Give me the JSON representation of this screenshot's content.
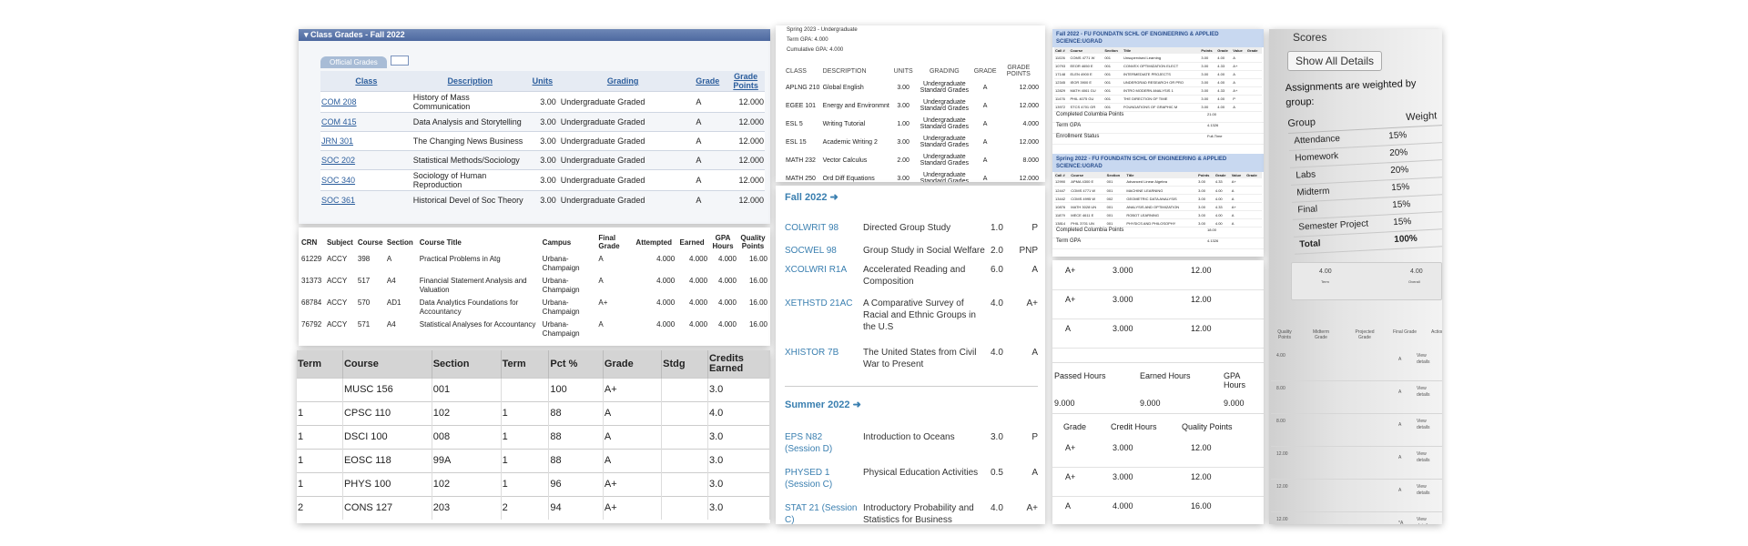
{
  "p1": {
    "header": "Class Grades - Fall 2022",
    "tab_official": "Official Grades",
    "tab_other": "",
    "columns": [
      "Class",
      "Description",
      "Units",
      "Grading",
      "Grade",
      "Grade Points"
    ],
    "rows": [
      {
        "class": "COM 208",
        "desc": "History of Mass Communication",
        "units": "3.00",
        "grading": "Undergraduate Graded",
        "grade": "A",
        "points": "12.000"
      },
      {
        "class": "COM 415",
        "desc": "Data Analysis and Storytelling",
        "units": "3.00",
        "grading": "Undergraduate Graded",
        "grade": "A",
        "points": "12.000"
      },
      {
        "class": "JRN 301",
        "desc": "The Changing News Business",
        "units": "3.00",
        "grading": "Undergraduate Graded",
        "grade": "A",
        "points": "12.000"
      },
      {
        "class": "SOC 202",
        "desc": "Statistical Methods/Sociology",
        "units": "3.00",
        "grading": "Undergraduate Graded",
        "grade": "A",
        "points": "12.000"
      },
      {
        "class": "SOC 340",
        "desc": "Sociology of Human Reproduction",
        "units": "3.00",
        "grading": "Undergraduate Graded",
        "grade": "A",
        "points": "12.000"
      },
      {
        "class": "SOC 361",
        "desc": "Historical Devel of Soc Theory",
        "units": "3.00",
        "grading": "Undergraduate Graded",
        "grade": "A",
        "points": "12.000"
      }
    ]
  },
  "p2": {
    "columns": [
      "CRN",
      "Subject",
      "Course",
      "Section",
      "Course Title",
      "Campus",
      "Final Grade",
      "Attempted",
      "Earned",
      "GPA Hours",
      "Quality Points"
    ],
    "rows": [
      {
        "crn": "61229",
        "subj": "ACCY",
        "course": "398",
        "sec": "A",
        "title": "Practical Problems in Atg",
        "campus": "Urbana-Champaign",
        "grade": "A",
        "att": "4.000",
        "earn": "4.000",
        "gpa": "4.000",
        "qp": "16.00"
      },
      {
        "crn": "31373",
        "subj": "ACCY",
        "course": "517",
        "sec": "A4",
        "title": "Financial Statement Analysis and Valuation",
        "campus": "Urbana-Champaign",
        "grade": "A",
        "att": "4.000",
        "earn": "4.000",
        "gpa": "4.000",
        "qp": "16.00"
      },
      {
        "crn": "68784",
        "subj": "ACCY",
        "course": "570",
        "sec": "AD1",
        "title": "Data Analytics Foundations for Accountancy",
        "campus": "Urbana-Champaign",
        "grade": "A+",
        "att": "4.000",
        "earn": "4.000",
        "gpa": "4.000",
        "qp": "16.00"
      },
      {
        "crn": "76792",
        "subj": "ACCY",
        "course": "571",
        "sec": "A4",
        "title": "Statistical Analyses for Accountancy",
        "campus": "Urbana-Champaign",
        "grade": "A",
        "att": "4.000",
        "earn": "4.000",
        "gpa": "4.000",
        "qp": "16.00"
      }
    ]
  },
  "p3": {
    "columns": [
      "Term",
      "Course",
      "Section",
      "Term",
      "Pct %",
      "Grade",
      "Stdg",
      "Credits Earned"
    ],
    "rows": [
      {
        "term": "",
        "course": "MUSC 156",
        "section": "001",
        "term2": "",
        "pct": "100",
        "grade": "A+",
        "stdg": "",
        "credits": "3.0"
      },
      {
        "term": "1",
        "course": "CPSC 110",
        "section": "102",
        "term2": "1",
        "pct": "88",
        "grade": "A",
        "stdg": "",
        "credits": "4.0"
      },
      {
        "term": "1",
        "course": "DSCI 100",
        "section": "008",
        "term2": "1",
        "pct": "88",
        "grade": "A",
        "stdg": "",
        "credits": "3.0"
      },
      {
        "term": "1",
        "course": "EOSC 118",
        "section": "99A",
        "term2": "1",
        "pct": "88",
        "grade": "A",
        "stdg": "",
        "credits": "3.0"
      },
      {
        "term": "1",
        "course": "PHYS 100",
        "section": "102",
        "term2": "1",
        "pct": "96",
        "grade": "A+",
        "stdg": "",
        "credits": "3.0"
      },
      {
        "term": "2",
        "course": "CONS 127",
        "section": "203",
        "term2": "2",
        "pct": "94",
        "grade": "A+",
        "stdg": "",
        "credits": "3.0"
      }
    ]
  },
  "p4": {
    "term": "Spring 2023 - Undergraduate",
    "term_gpa": "Term GPA: 4.000",
    "cum_gpa": "Cumulative GPA: 4.000",
    "columns": [
      "CLASS",
      "DESCRIPTION",
      "UNITS",
      "GRADING",
      "GRADE",
      "GRADE POINTS"
    ],
    "rows": [
      {
        "cls": "APLNG 210",
        "desc": "Global English",
        "units": "3.00",
        "grading": "Undergraduate Standard Grades",
        "grade": "A",
        "points": "12.000"
      },
      {
        "cls": "EGEE 101",
        "desc": "Energy and Environmnt",
        "units": "3.00",
        "grading": "Undergraduate Standard Grades",
        "grade": "A",
        "points": "12.000"
      },
      {
        "cls": "ESL 5",
        "desc": "Writing Tutorial",
        "units": "1.00",
        "grading": "Undergraduate Standard Grades",
        "grade": "A",
        "points": "4.000"
      },
      {
        "cls": "ESL 15",
        "desc": "Academic Writing 2",
        "units": "3.00",
        "grading": "Undergraduate Standard Grades",
        "grade": "A",
        "points": "12.000"
      },
      {
        "cls": "MATH 232",
        "desc": "Vector Calculus",
        "units": "2.00",
        "grading": "Undergraduate Standard Grades",
        "grade": "A",
        "points": "8.000"
      },
      {
        "cls": "MATH 250",
        "desc": "Ord Diff Equations",
        "units": "3.00",
        "grading": "Undergraduate Standard Grades",
        "grade": "A",
        "points": "12.000"
      }
    ]
  },
  "p5": {
    "fall_title": "Fall 2022",
    "fall_rows": [
      {
        "code": "COLWRIT 98",
        "title": "Directed Group Study",
        "units": "1.0",
        "grade": "P"
      },
      {
        "code": "SOCWEL 98",
        "title": "Group Study in Social Welfare",
        "units": "2.0",
        "grade": "PNP"
      },
      {
        "code": "XCOLWRI R1A",
        "title": "Accelerated Reading and Composition",
        "units": "6.0",
        "grade": "A"
      },
      {
        "code": "XETHSTD 21AC",
        "title": "A Comparative Survey of Racial and Ethnic Groups in the U.S",
        "units": "4.0",
        "grade": "A+"
      },
      {
        "code": "XHISTOR 7B",
        "title": "The United States from Civil War to Present",
        "units": "4.0",
        "grade": "A"
      }
    ],
    "summer_title": "Summer 2022",
    "summer_rows": [
      {
        "code": "EPS N82 (Session D)",
        "title": "Introduction to Oceans",
        "units": "3.0",
        "grade": "P"
      },
      {
        "code": "PHYSED 1 (Session C)",
        "title": "Physical Education Activities",
        "units": "0.5",
        "grade": "A"
      },
      {
        "code": "STAT 21 (Session C)",
        "title": "Introductory Probability and Statistics for Business",
        "units": "4.0",
        "grade": "A+"
      }
    ]
  },
  "p6": {
    "fall_header": "Fall 2022 - FU FOUNDATN SCHL OF ENGINEERING & APPLIED SCIENCE:UGRAD",
    "spring_header": "Spring 2022 - FU FOUNDATN SCHL OF ENGINEERING & APPLIED SCIENCE:UGRAD",
    "mini_columns": [
      "Call #",
      "Course",
      "Section",
      "Title",
      "Points",
      "Grade",
      "Value",
      "Grade"
    ],
    "fall_rows": [
      {
        "call": "11026",
        "course": "COMS 4771 W",
        "sec": "001",
        "title": "Unsupervised Learning",
        "pts": "3.00",
        "val": "4.00",
        "gr": "A"
      },
      {
        "call": "10793",
        "course": "EEOR 4650 E",
        "sec": "001",
        "title": "CONVEX OPTIMIZATION ELECT",
        "pts": "3.00",
        "val": "4.33",
        "gr": "A+"
      },
      {
        "call": "17148",
        "course": "ELEN 4900 E",
        "sec": "001",
        "title": "INTERMEDIATE PROJECTS",
        "pts": "3.00",
        "val": "4.00",
        "gr": "A"
      },
      {
        "call": "12345",
        "course": "IEOR 3900 E",
        "sec": "001",
        "title": "UNDERGRAD RESEARCH OR PRO",
        "pts": "3.00",
        "val": "4.00",
        "gr": "A"
      },
      {
        "call": "12829",
        "course": "MATH 4061 GU",
        "sec": "001",
        "title": "INTRO MODERN ANALYSIS 1",
        "pts": "3.00",
        "val": "4.33",
        "gr": "A+"
      },
      {
        "call": "11476",
        "course": "PHIL 4075 GU",
        "sec": "001",
        "title": "THE DIRECTION OF TIME",
        "pts": "3.00",
        "val": "4.00",
        "gr": "P"
      },
      {
        "call": "13972",
        "course": "STCS 4701 GR",
        "sec": "001",
        "title": "FOUNDATIONS OF GRAPHIC M",
        "pts": "3.00",
        "val": "4.00",
        "gr": "A"
      }
    ],
    "fall_summary": [
      {
        "label": "Completed Columbia Points",
        "value": "21.00"
      },
      {
        "label": "Term GPA",
        "value": "4.1326"
      },
      {
        "label": "Enrollment Status",
        "value": "Full-Time"
      }
    ],
    "spring_rows": [
      {
        "call": "12990",
        "course": "APMA 4300 E",
        "sec": "001",
        "title": "Advanced Linear Algebra",
        "pts": "3.00",
        "val": "4.33",
        "gr": "A+"
      },
      {
        "call": "12447",
        "course": "COMS 4771 W",
        "sec": "001",
        "title": "MACHINE LEARNING",
        "pts": "3.00",
        "val": "4.00",
        "gr": "A"
      },
      {
        "call": "13442",
        "course": "COMS 4995 W",
        "sec": "002",
        "title": "GEOMETRIC DATA ANALYSIS",
        "pts": "3.00",
        "val": "4.00",
        "gr": "A"
      },
      {
        "call": "10876",
        "course": "MATH 3028 UN",
        "sec": "001",
        "title": "ANALYSIS AND OPTIMIZATION",
        "pts": "3.00",
        "val": "4.33",
        "gr": "A+"
      },
      {
        "call": "11879",
        "course": "MECE 4611 E",
        "sec": "001",
        "title": "ROBOT LEARNING",
        "pts": "3.00",
        "val": "4.00",
        "gr": "A"
      },
      {
        "call": "13814",
        "course": "PHIL 3701 UN",
        "sec": "001",
        "title": "PHYSICS AND PHILOSOPHY",
        "pts": "3.00",
        "val": "4.00",
        "gr": "A"
      }
    ],
    "spring_summary": [
      {
        "label": "Completed Columbia Points",
        "value": "18.00"
      },
      {
        "label": "Term GPA",
        "value": "4.1326"
      }
    ]
  },
  "p7": {
    "rows_top": [
      {
        "grade": "A+",
        "credits": "3.000",
        "qp": "12.00"
      },
      {
        "grade": "A+",
        "credits": "3.000",
        "qp": "12.00"
      },
      {
        "grade": "A",
        "credits": "3.000",
        "qp": "12.00"
      }
    ],
    "mid_headers": [
      "Passed Hours",
      "Earned Hours",
      "GPA Hours"
    ],
    "mid_values": [
      "9.000",
      "9.000",
      "9.000"
    ],
    "bottom_headers": [
      "Grade",
      "Credit Hours",
      "Quality Points"
    ],
    "rows_bottom": [
      {
        "grade": "A+",
        "credits": "3.000",
        "qp": "12.00"
      },
      {
        "grade": "A+",
        "credits": "3.000",
        "qp": "12.00"
      },
      {
        "grade": "A",
        "credits": "4.000",
        "qp": "16.00"
      }
    ]
  },
  "p8": {
    "scores_label": "Scores",
    "show_details": "Show All Details",
    "weighted_text": "Assignments are weighted by group:",
    "col_group": "Group",
    "col_weight": "Weight",
    "weights": [
      {
        "group": "Attendance",
        "weight": "15%"
      },
      {
        "group": "Homework",
        "weight": "20%"
      },
      {
        "group": "Labs",
        "weight": "20%"
      },
      {
        "group": "Midterm",
        "weight": "15%"
      },
      {
        "group": "Final",
        "weight": "15%"
      },
      {
        "group": "Semester Project",
        "weight": "15%"
      },
      {
        "group": "Total",
        "weight": "100%"
      }
    ],
    "stat_left_value": "4.00",
    "stat_left_label": "Term",
    "stat_right_value": "4.00",
    "stat_right_label": "Overall",
    "columns": [
      "Quality Points",
      "Midterm Grade",
      "Projected Grade",
      "Final Grade",
      "Action"
    ],
    "rows": [
      {
        "qp": "4.00",
        "final": "A",
        "action": "View details"
      },
      {
        "qp": "8.00",
        "final": "A",
        "action": "View details"
      },
      {
        "qp": "8.00",
        "final": "A",
        "action": "View details"
      },
      {
        "qp": "12.00",
        "final": "A",
        "action": "View details"
      },
      {
        "qp": "12.00",
        "final": "A",
        "action": "View details"
      },
      {
        "qp": "12.00",
        "final": "*A",
        "action": "View details"
      }
    ]
  }
}
